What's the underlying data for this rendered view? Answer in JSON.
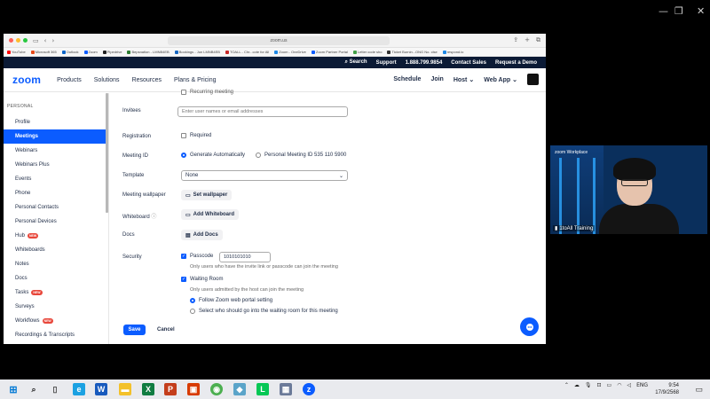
{
  "browser": {
    "url": "zoom.us",
    "bookmarks": [
      "YouTube",
      "Microsoft 365",
      "Outlook",
      "Zoom",
      "Pipedrive",
      "Bepsnation - LMNB4EB",
      "Bookings - Jun LMNB4EB",
      "TOALL - Chr...cote for All",
      "Zoom - OneDrive",
      "Zoom Partner Portal",
      "Letter code sho",
      "Ticket Burnin...ONG No. clse",
      "respond.io"
    ]
  },
  "topbar": {
    "search": "Search",
    "support": "Support",
    "phone": "1.888.799.9854",
    "contact_sales": "Contact Sales",
    "request_demo": "Request a Demo"
  },
  "nav": {
    "logo": "zoom",
    "items": [
      "Products",
      "Solutions",
      "Resources",
      "Plans & Pricing"
    ],
    "right": {
      "schedule": "Schedule",
      "join": "Join",
      "host": "Host",
      "web_app": "Web App"
    }
  },
  "sidebar": {
    "header": "PERSONAL",
    "items": [
      {
        "label": "Profile"
      },
      {
        "label": "Meetings",
        "active": true
      },
      {
        "label": "Webinars"
      },
      {
        "label": "Webinars Plus"
      },
      {
        "label": "Events"
      },
      {
        "label": "Phone"
      },
      {
        "label": "Personal Contacts"
      },
      {
        "label": "Personal Devices"
      },
      {
        "label": "Hub",
        "badge": "NEW"
      },
      {
        "label": "Whiteboards"
      },
      {
        "label": "Notes"
      },
      {
        "label": "Docs"
      },
      {
        "label": "Tasks",
        "badge": "NEW"
      },
      {
        "label": "Surveys"
      },
      {
        "label": "Workflows",
        "badge": "NEW"
      },
      {
        "label": "Recordings & Transcripts"
      }
    ]
  },
  "form": {
    "recurring_label": "Recurring meeting",
    "invitees_label": "Invitees",
    "invitees_placeholder": "Enter user names or email addresses",
    "registration_label": "Registration",
    "registration_option": "Required",
    "meeting_id_label": "Meeting ID",
    "meeting_id_auto": "Generate Automatically",
    "meeting_id_personal": "Personal Meeting ID 535 110 5900",
    "template_label": "Template",
    "template_value": "None",
    "wallpaper_label": "Meeting wallpaper",
    "wallpaper_button": "Set wallpaper",
    "whiteboard_label": "Whiteboard",
    "whiteboard_button": "Add Whiteboard",
    "docs_label": "Docs",
    "docs_button": "Add Docs",
    "security_label": "Security",
    "passcode_label": "Passcode",
    "passcode_value": "1010101010",
    "passcode_note": "Only users who have the invite link or passcode can join the meeting",
    "waiting_room_label": "Waiting Room",
    "waiting_room_note": "Only users admitted by the host can join the meeting",
    "waiting_option_1": "Follow Zoom web portal setting",
    "waiting_option_2": "Select who should go into the waiting room for this meeting",
    "save": "Save",
    "cancel": "Cancel"
  },
  "video": {
    "banner": "zoom Workplace",
    "name": "1toAll Training"
  },
  "taskbar": {
    "lang": "ENG",
    "time": "9:54",
    "date": "17/9/2568"
  },
  "colors": {
    "accent": "#0b5cff",
    "topbar": "#0b1a35",
    "badge": "#e8473b"
  }
}
